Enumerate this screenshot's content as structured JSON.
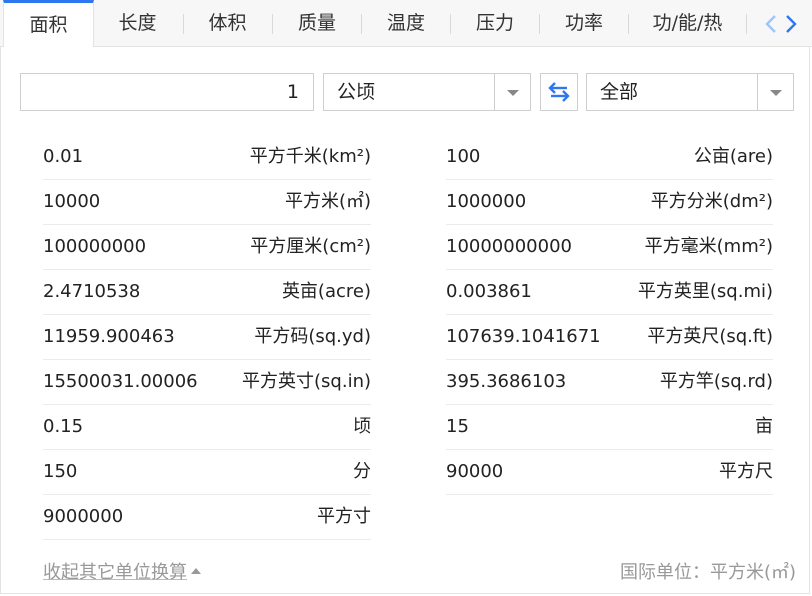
{
  "tabs": [
    {
      "label": "面积",
      "active": true
    },
    {
      "label": "长度"
    },
    {
      "label": "体积"
    },
    {
      "label": "质量"
    },
    {
      "label": "温度"
    },
    {
      "label": "压力"
    },
    {
      "label": "功率"
    },
    {
      "label": "功/能/热"
    }
  ],
  "converter": {
    "input_value": "1",
    "from_unit": "公顷",
    "to_unit": "全部"
  },
  "results_left": [
    {
      "value": "0.01",
      "unit": "平方千米(km²)"
    },
    {
      "value": "10000",
      "unit": "平方米(㎡)"
    },
    {
      "value": "100000000",
      "unit": "平方厘米(cm²)"
    },
    {
      "value": "2.4710538",
      "unit": "英亩(acre)"
    },
    {
      "value": "11959.900463",
      "unit": "平方码(sq.yd)"
    },
    {
      "value": "15500031.00006",
      "unit": "平方英寸(sq.in)"
    },
    {
      "value": "0.15",
      "unit": "顷"
    },
    {
      "value": "150",
      "unit": "分"
    },
    {
      "value": "9000000",
      "unit": "平方寸"
    }
  ],
  "results_right": [
    {
      "value": "100",
      "unit": "公亩(are)"
    },
    {
      "value": "1000000",
      "unit": "平方分米(dm²)"
    },
    {
      "value": "10000000000",
      "unit": "平方毫米(mm²)"
    },
    {
      "value": "0.003861",
      "unit": "平方英里(sq.mi)"
    },
    {
      "value": "107639.1041671",
      "unit": "平方英尺(sq.ft)"
    },
    {
      "value": "395.3686103",
      "unit": "平方竿(sq.rd)"
    },
    {
      "value": "15",
      "unit": "亩"
    },
    {
      "value": "90000",
      "unit": "平方尺"
    }
  ],
  "footer": {
    "collapse_label": "收起其它单位换算",
    "si_unit_label": "国际单位：平方米(㎡)"
  },
  "colors": {
    "accent": "#2e77ee"
  },
  "icons": {
    "swap": "swap-arrows-icon",
    "prev": "chevron-left-icon",
    "next": "chevron-right-icon",
    "dropdown": "triangle-down-icon"
  }
}
